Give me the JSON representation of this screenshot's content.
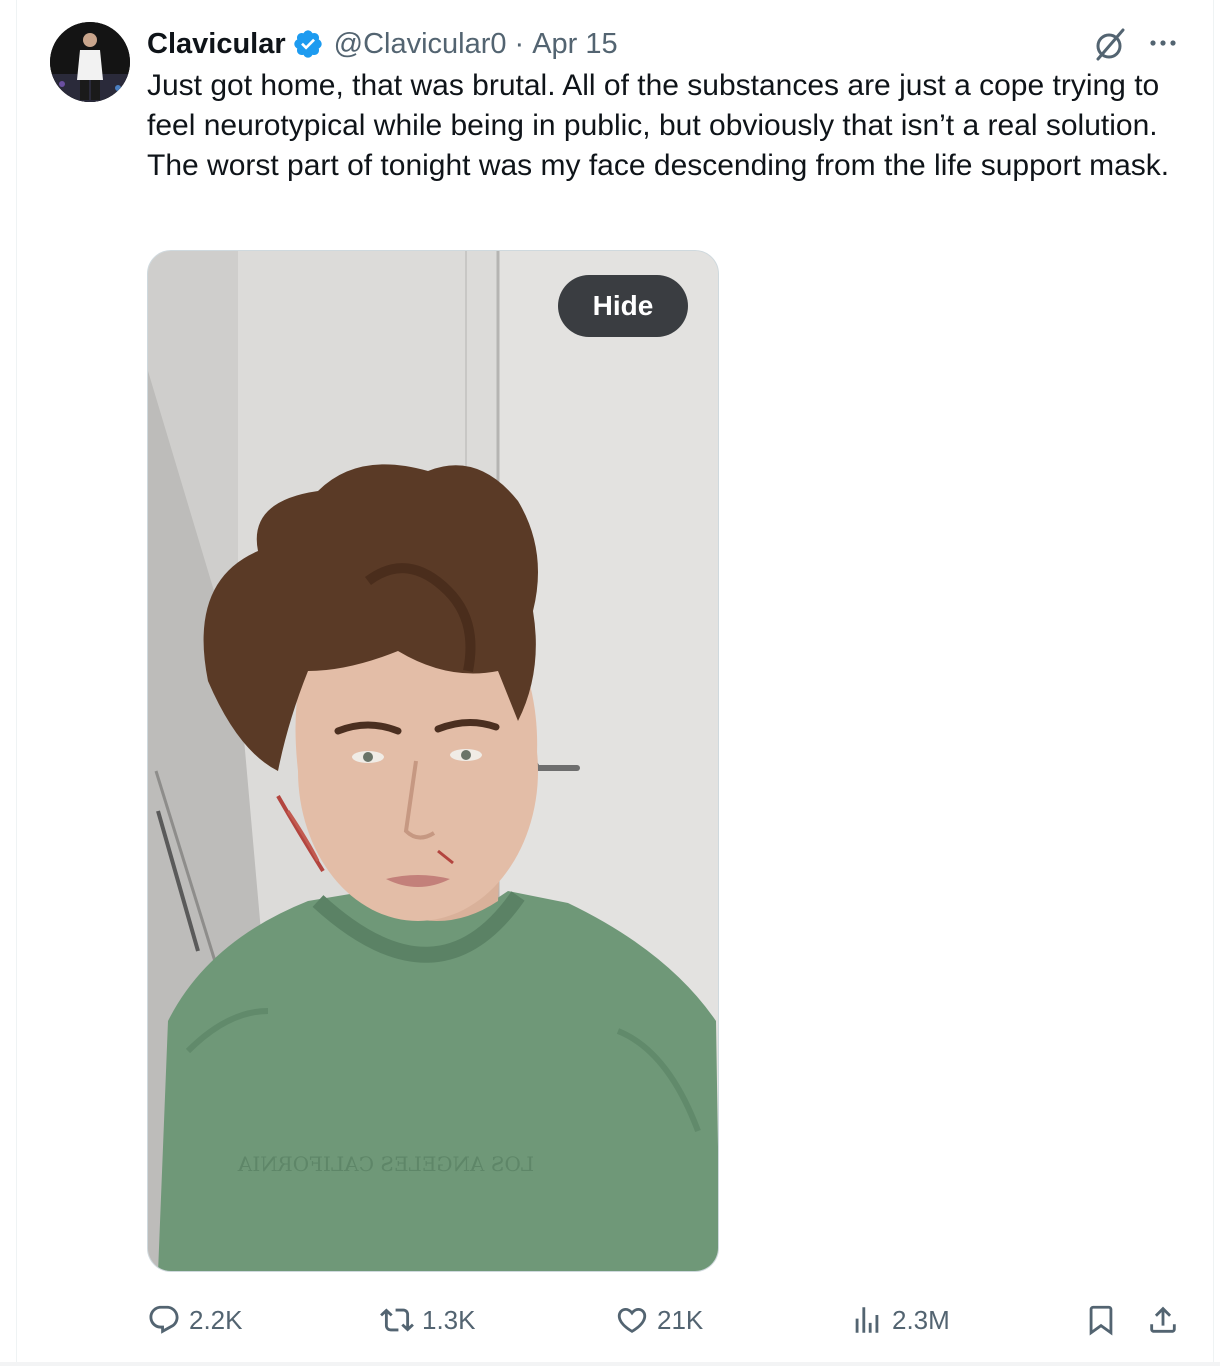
{
  "post": {
    "author_name": "Clavicular",
    "handle": "@Clavicular0",
    "separator": "·",
    "date": "Apr 15",
    "verified": true,
    "text": "Just got home, that was brutal. All of the substances are just a cope trying to feel neurotypical while being in public, but obviously that isn’t a real solution. The worst part of tonight was my face descending from the life support mask.",
    "media": {
      "hide_label": "Hide",
      "shirt_print": "LOS ANGELES CALIFORNIA"
    }
  },
  "actions": {
    "replies": "2.2K",
    "reposts": "1.3K",
    "likes": "21K",
    "views": "2.3M"
  },
  "icons": [
    "verified-badge-icon",
    "grok-icon",
    "more-icon",
    "reply-icon",
    "repost-icon",
    "like-icon",
    "views-icon",
    "bookmark-icon",
    "share-icon"
  ],
  "colors": {
    "verified_blue": "#1d9bf0",
    "text_primary": "#0f1419",
    "text_secondary": "#536471",
    "shirt_green": "#6f9878"
  }
}
